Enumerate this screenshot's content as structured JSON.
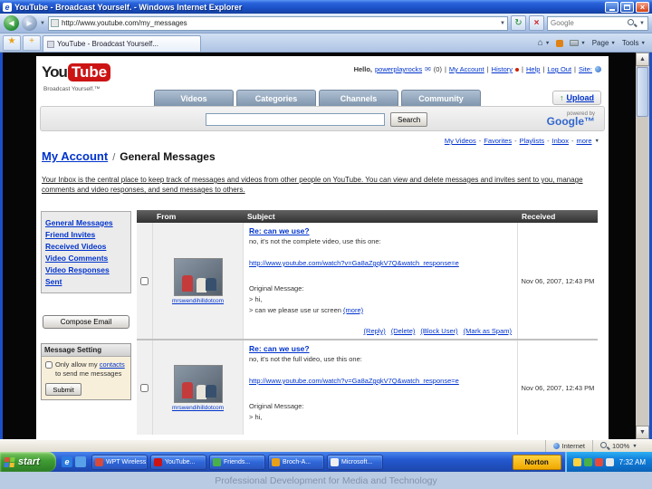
{
  "browser": {
    "title": "YouTube - Broadcast Yourself. - Windows Internet Explorer",
    "address": "http://www.youtube.com/my_messages",
    "search_placeholder": "Google",
    "tab_title": "YouTube - Broadcast Yourself...",
    "page_menu": "Page",
    "tools_menu": "Tools",
    "status_internet": "Internet",
    "zoom": "100%"
  },
  "icons": {
    "ie_logo": "e",
    "back": "◀",
    "forward": "▶",
    "dropdown": "▼",
    "refresh": "↻",
    "stop": "×",
    "star": "★",
    "star_plus": "+",
    "home": "⌂",
    "mail": "✉",
    "upload_arrow": "↑",
    "scroll_up": "▲",
    "scroll_down": "▼",
    "close": "×"
  },
  "symbols": {
    "pipe": "|",
    "slash": "/",
    "dash": "-"
  },
  "yt": {
    "logo_you": "You",
    "logo_tube": "Tube",
    "tagline": "Broadcast Yourself.™",
    "greeting": "Hello,",
    "username": "powerplayrocks",
    "inbox_count": "(0)",
    "link_my_account": "My Account",
    "link_history": "History",
    "link_help": "Help",
    "link_log_out": "Log Out",
    "link_site": "Site:",
    "tabs": [
      "Videos",
      "Categories",
      "Channels",
      "Community"
    ],
    "upload": "Upload",
    "search_button": "Search",
    "powered_by": "powered by",
    "google": "Google™",
    "quick_links": [
      "My Videos",
      "Favorites",
      "Playlists",
      "Inbox",
      "more"
    ],
    "crumb_parent": "My Account",
    "crumb_current": "General Messages",
    "intro": "Your Inbox is the central place to keep track of messages and videos from other people on YouTube. You can view and delete messages and invites sent to you, manage comments and video responses, and send messages to others.",
    "sidebar": {
      "items": [
        "General Messages",
        "Friend Invites",
        "Received Videos",
        "Video Comments",
        "Video Responses",
        "Sent"
      ],
      "compose": "Compose Email",
      "settings_title": "Message Setting",
      "settings_pre": "Only allow my",
      "settings_link": "contacts",
      "settings_post": "to send me messages",
      "submit": "Submit"
    },
    "table": {
      "col_from": "From",
      "col_subject": "Subject",
      "col_received": "Received",
      "rows": [
        {
          "from": "mrswendihilldotcom",
          "subject": "Re: can we use?",
          "body1": "no, it's not the complete video, use this one:",
          "url": "http://www.youtube.com/watch?v=Ga8aZgqkV7Q&watch_response=e",
          "orig": "Original Message:",
          "quote1": "> hi,",
          "quote2": "> can we please use ur screen",
          "more": "(more)",
          "reply": "(Reply)",
          "delete": "(Delete)",
          "block": "(Block User)",
          "spam": "(Mark as Spam)",
          "received": "Nov 06, 2007, 12:43 PM"
        },
        {
          "from": "mrswendihilldotcom",
          "subject": "Re: can we use?",
          "body1": "no, it's not the full video, use this one:",
          "url": "http://www.youtube.com/watch?v=Ga8aZgqkV7Q&watch_response=e",
          "orig": "Original Message:",
          "quote1": "> hi,",
          "received": "Nov 06, 2007, 12:43 PM"
        }
      ]
    }
  },
  "taskbar": {
    "start": "start",
    "buttons": [
      "WPT Wireless...",
      "YouTube...",
      "Friends...",
      "Broch-A...",
      "Microsoft..."
    ],
    "norton": "Norton",
    "time": "7:32 AM"
  },
  "caption": "Professional Development for Media and Technology"
}
